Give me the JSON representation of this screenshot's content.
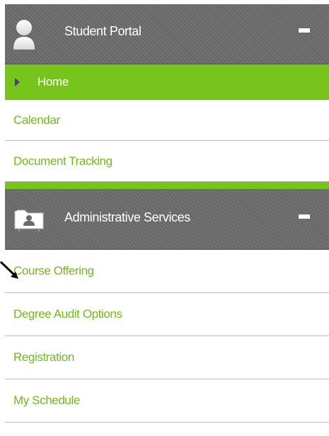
{
  "sections": [
    {
      "title": "Student Portal",
      "icon": "user-silhouette-icon",
      "collapse_label": "collapse",
      "items": [
        {
          "label": "Home",
          "active": true
        },
        {
          "label": "Calendar"
        },
        {
          "label": "Document Tracking"
        }
      ]
    },
    {
      "title": "Administrative Services",
      "icon": "admin-folder-user-icon",
      "collapse_label": "collapse",
      "items": [
        {
          "label": "Course Offering"
        },
        {
          "label": "Degree Audit Options"
        },
        {
          "label": "Registration"
        },
        {
          "label": "My Schedule"
        }
      ]
    }
  ],
  "annotation": {
    "icon": "pointer-arrow-icon",
    "target": "Course Offering"
  },
  "colors": {
    "header_bg": "#6c6c6c",
    "accent_green": "#77c51c",
    "link_green": "#72b81e",
    "caret": "#4a3c8f",
    "divider": "#b9b9b9"
  }
}
